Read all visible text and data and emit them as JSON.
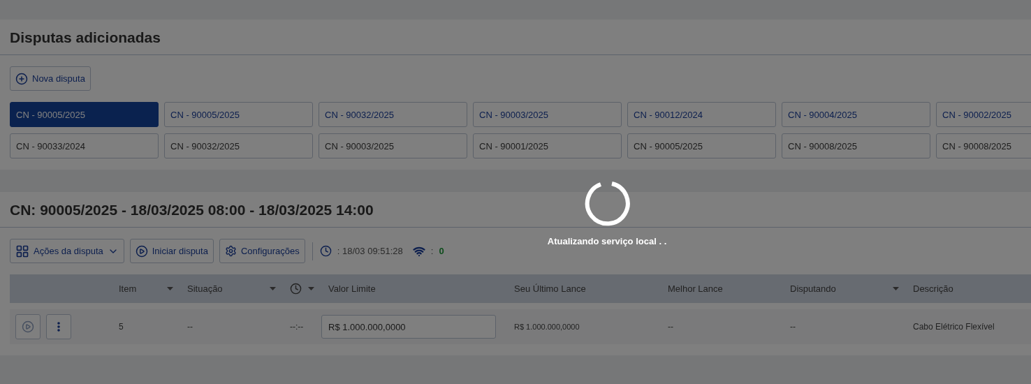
{
  "section_title": "Disputas adicionadas",
  "new_button": "Nova disputa",
  "dispute_tabs": [
    [
      {
        "label": "CN - 90005/2025",
        "selected": true,
        "active": true
      },
      {
        "label": "CN - 90005/2025",
        "selected": false,
        "active": true
      },
      {
        "label": "CN - 90032/2025",
        "selected": false,
        "active": true
      },
      {
        "label": "CN - 90003/2025",
        "selected": false,
        "active": true
      },
      {
        "label": "CN - 90012/2024",
        "selected": false,
        "active": true
      },
      {
        "label": "CN - 90004/2025",
        "selected": false,
        "active": true
      },
      {
        "label": "CN - 90002/2025",
        "selected": false,
        "active": true
      }
    ],
    [
      {
        "label": "CN - 90033/2024",
        "selected": false,
        "active": false
      },
      {
        "label": "CN - 90032/2025",
        "selected": false,
        "active": false
      },
      {
        "label": "CN - 90003/2025",
        "selected": false,
        "active": false
      },
      {
        "label": "CN - 90001/2025",
        "selected": false,
        "active": false
      },
      {
        "label": "CN - 90005/2025",
        "selected": false,
        "active": false
      },
      {
        "label": "CN - 90008/2025",
        "selected": false,
        "active": false
      },
      {
        "label": "CN - 90008/2025",
        "selected": false,
        "active": false
      }
    ]
  ],
  "dispute": {
    "title": "CN: 90005/2025 - 18/03/2025 08:00 - 18/03/2025 14:00",
    "toolbar": {
      "actions_button": "Ações da disputa",
      "start_button": "Iniciar disputa",
      "settings_button": "Configurações",
      "clock_reading": ": 18/03 09:51:28",
      "connection_label": ":",
      "connection_count": "0"
    },
    "table": {
      "columns": [
        {
          "kind": "actions"
        },
        {
          "kind": "text",
          "label": "Item",
          "sortable": true
        },
        {
          "kind": "text",
          "label": "Situação",
          "sortable": true
        },
        {
          "kind": "clock",
          "sortable": true
        },
        {
          "kind": "input",
          "label": "Valor Limite",
          "sortable": false
        },
        {
          "kind": "small",
          "label": "Seu Último Lance",
          "sortable": false
        },
        {
          "kind": "text",
          "label": "Melhor Lance",
          "sortable": false
        },
        {
          "kind": "text",
          "label": "Disputando",
          "sortable": true
        },
        {
          "kind": "text",
          "label": "Descrição",
          "sortable": false
        }
      ],
      "rows": [
        {
          "cells": [
            "",
            "5",
            "--",
            "--:--",
            "R$ 1.000.000,0000",
            "R$ 1.000.000,0000",
            "--",
            "--",
            "Cabo Elétrico Flexível"
          ]
        }
      ]
    }
  },
  "loading": {
    "message": "Atualizando serviço local . ."
  }
}
